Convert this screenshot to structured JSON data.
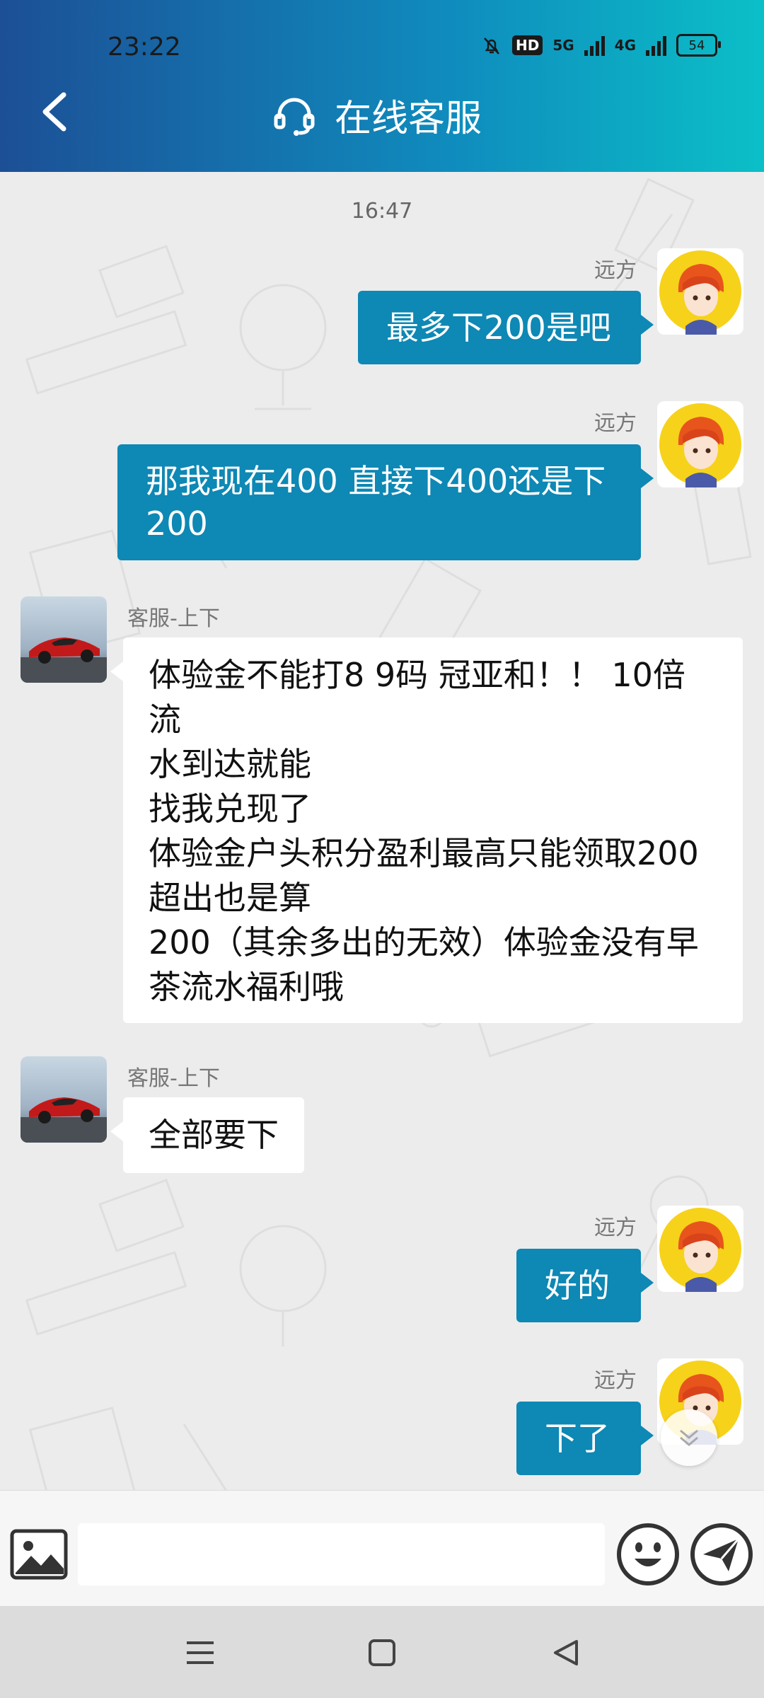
{
  "status_bar": {
    "time": "23:22",
    "hd": "HD",
    "net1": "5G",
    "net2": "4G",
    "battery": "54"
  },
  "header": {
    "title": "在线客服"
  },
  "chat": {
    "timestamp": "16:47",
    "messages": [
      {
        "sender": "远方",
        "side": "out",
        "text": "最多下200是吧"
      },
      {
        "sender": "远方",
        "side": "out",
        "lines": [
          "那我现在400 直接下400还是下",
          "200"
        ]
      },
      {
        "sender": "客服-上下",
        "side": "in",
        "lines": [
          "体验金不能打8 9码 冠亚和！！ 10倍流",
          "水到达就能",
          "找我兑现了",
          "体验金户头积分盈利最高只能领取200",
          "超出也是算",
          "200（其余多出的无效）体验金没有早",
          "茶流水福利哦"
        ]
      },
      {
        "sender": "客服-上下",
        "side": "in",
        "text": "全部要下"
      },
      {
        "sender": "远方",
        "side": "out",
        "text": "好的"
      },
      {
        "sender": "远方",
        "side": "out",
        "text": "下了"
      }
    ]
  },
  "input": {
    "placeholder": ""
  },
  "colors": {
    "header_start": "#1c4f96",
    "header_end": "#0bbfc7",
    "outgoing_bubble": "#0e88b4",
    "incoming_bubble": "#ffffff"
  },
  "icons": [
    "back-icon",
    "headset-icon",
    "image-icon",
    "emoji-icon",
    "send-icon",
    "scroll-down-icon",
    "menu-icon",
    "home-icon",
    "back-triangle-icon"
  ]
}
